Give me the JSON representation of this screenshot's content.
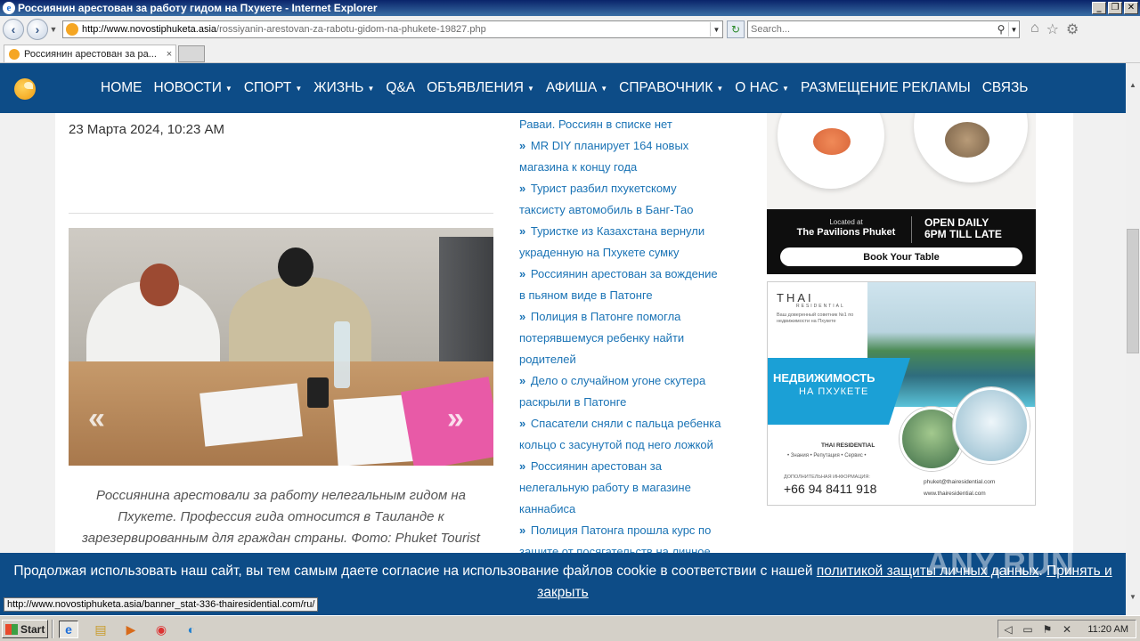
{
  "window": {
    "title": "Россиянин арестован за работу гидом на Пхукете - Internet Explorer",
    "buttons": {
      "minimize": "_",
      "restore": "❐",
      "close": "✕"
    }
  },
  "browser": {
    "url_host": "http://www.novostiphuketa.asia",
    "url_path": "/rossiyanin-arestovan-za-rabotu-gidom-na-phukete-19827.php",
    "search_placeholder": "Search...",
    "tab_label": "Россиянин арестован за ра...",
    "status_url": "http://www.novostiphuketa.asia/banner_stat-336-thairesidential.com/ru/"
  },
  "nav": {
    "items": [
      {
        "label": "HOME",
        "caret": false
      },
      {
        "label": "НОВОСТИ",
        "caret": true
      },
      {
        "label": "СПОРТ",
        "caret": true
      },
      {
        "label": "ЖИЗНЬ",
        "caret": true
      },
      {
        "label": "Q&A",
        "caret": false
      },
      {
        "label": "ОБЪЯВЛЕНИЯ",
        "caret": true
      },
      {
        "label": "АФИША",
        "caret": true
      },
      {
        "label": "СПРАВОЧНИК",
        "caret": true
      },
      {
        "label": "О НАС",
        "caret": true
      },
      {
        "label": "РАЗМЕЩЕНИЕ РЕКЛАМЫ",
        "caret": false
      },
      {
        "label": "СВЯЗЬ",
        "caret": false
      }
    ]
  },
  "article": {
    "date": "23 Марта 2024, 10:23 AM",
    "photo_prev": "«",
    "photo_next": "»",
    "caption": "Россиянина арестовали за работу нелегальным гидом на Пхукете. Профессия гида относится в Таиланде к зарезервированным для граждан страны. Фото: Phuket Tourist"
  },
  "news": {
    "bullet": "»",
    "top_fragment": "Раваи. Россиян в списке нет",
    "items": [
      "MR DIY планирует 164 новых магазина к концу года",
      "Турист разбил пхукетскому таксисту автомобиль в Банг-Тао",
      "Туристке из Казахстана вернули украденную на Пхукете сумку",
      "Россиянин арестован за вождение в пьяном виде в Патонге",
      "Полиция в Патонге помогла потерявшемуся ребенку найти родителей",
      "Дело о случайном угоне скутера раскрыли в Патонге",
      "Спасатели сняли с пальца ребенка кольцо с засунутой под него ложкой",
      "Россиянин арестован за нелегальную работу в магазине каннабиса",
      "Полиция Патонга прошла курс по защите от посягательств на личное"
    ]
  },
  "ad_pavilions": {
    "located_at": "Located at",
    "venue": "The Pavilions Phuket",
    "open_line1": "OPEN DAILY",
    "open_line2": "6PM TILL LATE",
    "cta": "Book Your Table"
  },
  "ad_thai": {
    "brand": "THAI",
    "brand_sub": "RESIDENTIAL",
    "brand_desc": "Ваш доверенный советник №1 по недвижимости на Пхукете",
    "headline1": "НЕДВИЖИМОСТЬ",
    "headline2": "НА ПХУКЕТЕ",
    "company": "THAI RESIDENTIAL",
    "values": "• Знания • Репутация • Сервис •",
    "info_label": "ДОПОЛНИТЕЛЬНАЯ ИНФОРМАЦИЯ:",
    "phone": "+66 94 8411 918",
    "email": "phuket@thairesidential.com",
    "website": "www.thairesidential.com"
  },
  "cookie": {
    "text_before": "Продолжая использовать наш сайт, вы тем самым даете согласие на использование файлов cookie в соответствии с нашей ",
    "policy_link": "политикой защиты личных данных",
    "separator": ". ",
    "accept_link": "Принять и закрыть"
  },
  "watermark": "ANY.RUN",
  "taskbar": {
    "start_label": "Start",
    "clock": "11:20 AM"
  },
  "colors": {
    "site_blue": "#0d4c87",
    "link_blue": "#1a73b5",
    "ad_cyan": "#1ba0d6"
  }
}
